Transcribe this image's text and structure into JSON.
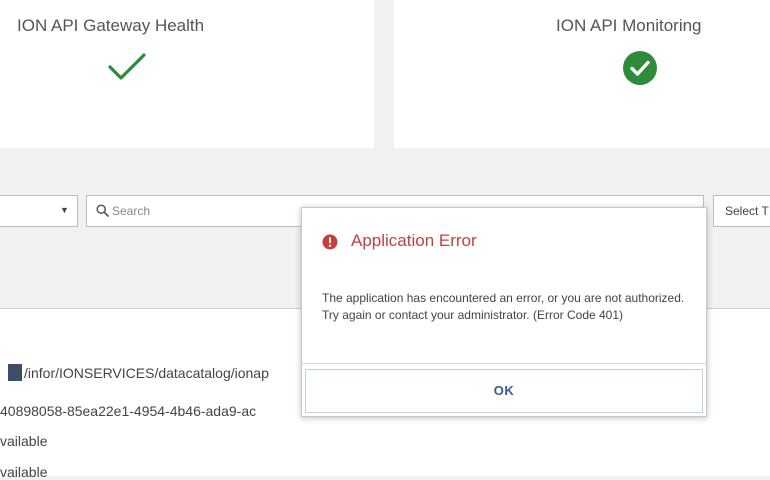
{
  "cards": [
    {
      "title": "ION API Gateway Health",
      "status_icon": "checkmark-icon"
    },
    {
      "title": "ION API Monitoring",
      "status_icon": "check-circle-icon"
    }
  ],
  "colors": {
    "success_green": "#2e8b3a",
    "error_red": "#c3403e",
    "ok_text": "#3b5998"
  },
  "toolbar": {
    "dropdown_icon": "caret-down-icon",
    "search": {
      "placeholder": "Search"
    },
    "select_button_label": "Select T"
  },
  "details": {
    "path": "/infor/IONSERVICES/datacatalog/ionap",
    "id": "40898058-85ea22e1-4954-4b46-ada9-ac",
    "status_1": "vailable",
    "status_2": "vailable"
  },
  "modal": {
    "title": "Application Error",
    "message": "The application has encountered an error, or you are not authorized. Try again or contact your administrator. (Error Code 401)",
    "ok_label": "OK"
  }
}
